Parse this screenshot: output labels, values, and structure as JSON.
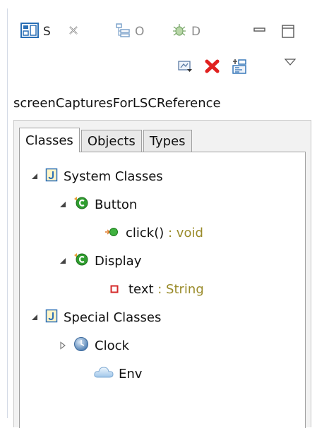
{
  "view_tabs": [
    {
      "label": "S",
      "icon": "structure-view-icon",
      "state": "active"
    },
    {
      "label": "O",
      "icon": "outline-icon",
      "state": "inactive"
    },
    {
      "label": "D",
      "icon": "debug-icon",
      "state": "inactive"
    }
  ],
  "toolbar": {
    "icons": [
      "open-diagram-icon",
      "remove-icon",
      "layout-icon",
      "view-menu-icon"
    ]
  },
  "root_label": "screenCapturesForLSCReference",
  "inner_tabs": [
    "Classes",
    "Objects",
    "Types"
  ],
  "tree": {
    "system_classes": "System Classes",
    "button": "Button",
    "click_method": "click()",
    "click_type": ": void",
    "display": "Display",
    "text_field": "text",
    "text_type": ": String",
    "special_classes": "Special Classes",
    "clock": "Clock",
    "env": "Env"
  },
  "colors": {
    "type_text": "#9a8b2a",
    "class_icon_green": "#2f9e2f",
    "remove_red": "#e0211f",
    "package_icon_blue": "#2a6fb5"
  }
}
